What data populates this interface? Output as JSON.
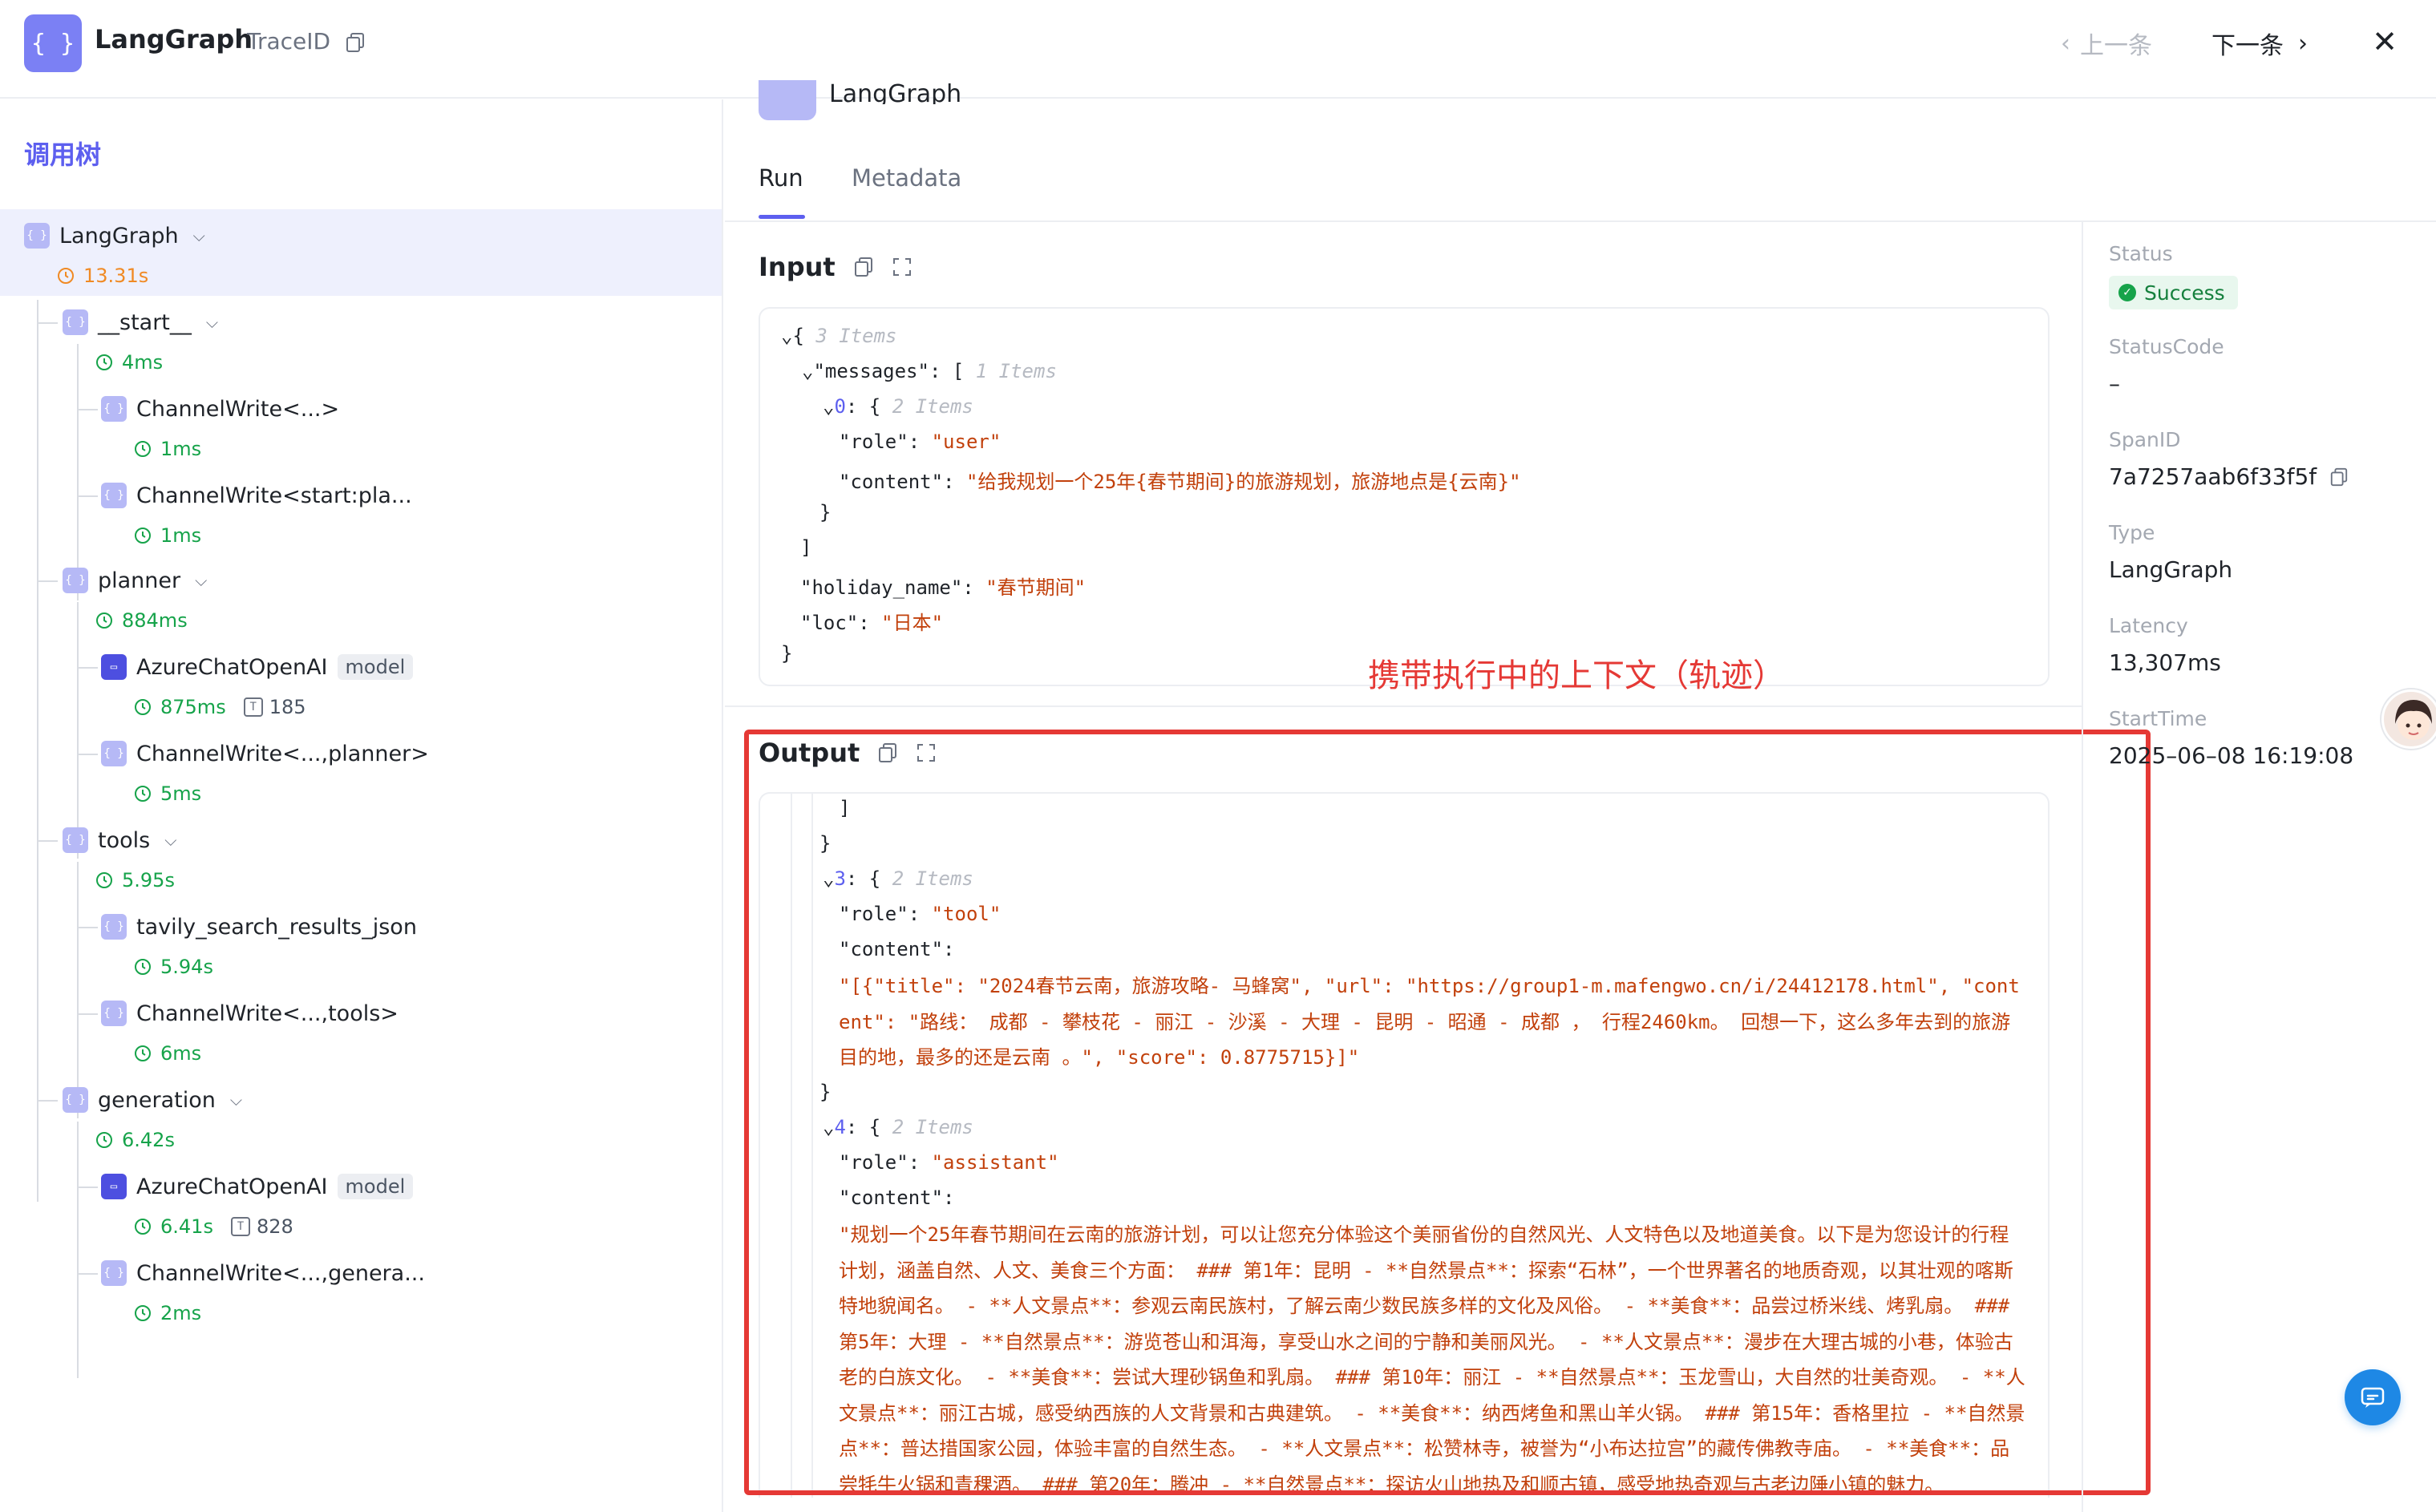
{
  "header": {
    "app_icon": "{ }",
    "title": "LangGraph",
    "trace_label": "TraceID",
    "prev_label": "上一条",
    "next_label": "下一条"
  },
  "tree": {
    "title": "调用树",
    "nodes": [
      {
        "label": "LangGraph",
        "duration": "13.31s"
      },
      {
        "label": "__start__",
        "duration": "4ms"
      },
      {
        "label": "ChannelWrite<...>",
        "duration": "1ms"
      },
      {
        "label": "ChannelWrite<start:pla...",
        "duration": "1ms"
      },
      {
        "label": "planner",
        "duration": "884ms"
      },
      {
        "label": "AzureChatOpenAI",
        "tag": "model",
        "duration": "875ms",
        "tokens": "185"
      },
      {
        "label": "ChannelWrite<...,planner>",
        "duration": "5ms"
      },
      {
        "label": "tools",
        "duration": "5.95s"
      },
      {
        "label": "tavily_search_results_json",
        "duration": "5.94s"
      },
      {
        "label": "ChannelWrite<...,tools>",
        "duration": "6ms"
      },
      {
        "label": "generation",
        "duration": "6.42s"
      },
      {
        "label": "AzureChatOpenAI",
        "tag": "model",
        "duration": "6.41s",
        "tokens": "828"
      },
      {
        "label": "ChannelWrite<...,genera...",
        "duration": "2ms"
      }
    ]
  },
  "main": {
    "top_text": "LangGraph",
    "tabs": [
      "Run",
      "Metadata"
    ],
    "input_title": "Input",
    "output_title": "Output",
    "annotation": "携带执行中的上下文（轨迹）",
    "input": {
      "root_count": "3 Items",
      "messages_key": "\"messages\"",
      "messages_count": "1 Items",
      "item0_key": "0",
      "item0_count": "2 Items",
      "role_key": "\"role\"",
      "role_val": "\"user\"",
      "content_key": "\"content\"",
      "content_val": "\"给我规划一个25年{春节期间}的旅游规划，旅游地点是{云南}\"",
      "holiday_key": "\"holiday_name\"",
      "holiday_val": "\"春节期间\"",
      "loc_key": "\"loc\"",
      "loc_val": "\"日本\""
    },
    "output": {
      "item3_key": "3",
      "item3_count": "2 Items",
      "role3_key": "\"role\"",
      "role3_val": "\"tool\"",
      "content3_key": "\"content\"",
      "content3_val": "\"[{\"title\": \"2024春节云南，旅游攻略- 马蜂窝\", \"url\": \"https://group1-m.mafengwo.cn/i/24412178.html\", \"content\": \"路线： 成都 - 攀枝花 - 丽江 - 沙溪 - 大理 - 昆明 - 昭通 - 成都 ， 行程2460km。 回想一下，这么多年去到的旅游目的地，最多的还是云南 。\", \"score\": 0.8775715}]\"",
      "item4_key": "4",
      "item4_count": "2 Items",
      "role4_key": "\"role\"",
      "role4_val": "\"assistant\"",
      "content4_key": "\"content\"",
      "content4_val": "\"规划一个25年春节期间在云南的旅游计划，可以让您充分体验这个美丽省份的自然风光、人文特色以及地道美食。以下是为您设计的行程计划，涵盖自然、人文、美食三个方面： ### 第1年：昆明 - **自然景点**：探索“石林”，一个世界著名的地质奇观，以其壮观的喀斯特地貌闻名。 - **人文景点**：参观云南民族村，了解云南少数民族多样的文化及风俗。 - **美食**：品尝过桥米线、烤乳扇。 ### 第5年：大理 - **自然景点**：游览苍山和洱海，享受山水之间的宁静和美丽风光。 - **人文景点**：漫步在大理古城的小巷，体验古老的白族文化。 - **美食**：尝试大理砂锅鱼和乳扇。 ### 第10年：丽江 - **自然景点**：玉龙雪山，大自然的壮美奇观。 - **人文景点**：丽江古城，感受纳西族的人文背景和古典建筑。 - **美食**：纳西烤鱼和黑山羊火锅。 ### 第15年：香格里拉 - **自然景点**：普达措国家公园，体验丰富的自然生态。 - **人文景点**：松赞林寺，被誉为“小布达拉宫”的藏传佛教寺庙。 - **美食**：品尝牦牛火锅和青稞酒。 ### 第20年：腾冲 - **自然景点**：探访火山地热及和顺古镇，感受地热奇观与古老边陲小镇的魅力。"
    }
  },
  "info": {
    "status_label": "Status",
    "status_value": "Success",
    "status_code_label": "StatusCode",
    "status_code_value": "–",
    "span_label": "SpanID",
    "span_value": "7a7257aab6f33f5f",
    "type_label": "Type",
    "type_value": "LangGraph",
    "latency_label": "Latency",
    "latency_value": "13,307ms",
    "start_label": "StartTime",
    "start_value": "2025–06–08 16:19:08"
  },
  "colors": {
    "accent": "#5d5fef",
    "success": "#16a34a",
    "annotation": "#e53935",
    "string": "#c2410c"
  }
}
